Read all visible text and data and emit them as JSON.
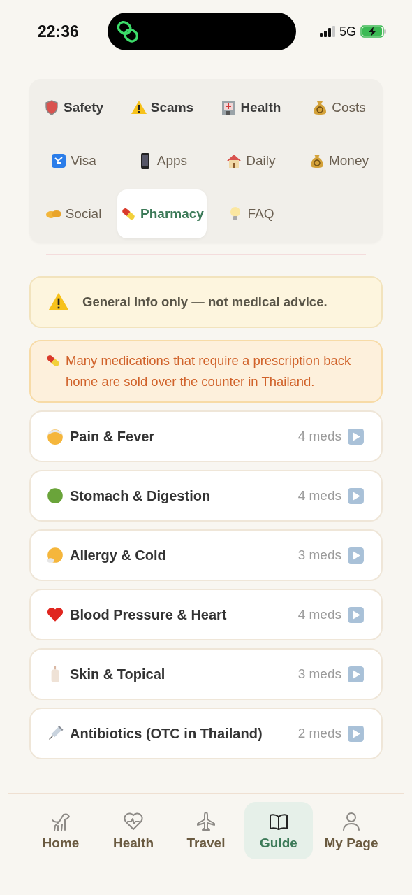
{
  "status_bar": {
    "time": "22:36",
    "network": "5G"
  },
  "tabs": [
    {
      "label": "Safety",
      "strong": true,
      "selected": false
    },
    {
      "label": "Scams",
      "strong": true,
      "selected": false
    },
    {
      "label": "Health",
      "strong": true,
      "selected": false
    },
    {
      "label": "Costs",
      "strong": false,
      "selected": false
    },
    {
      "label": "Visa",
      "strong": false,
      "selected": false
    },
    {
      "label": "Apps",
      "strong": false,
      "selected": false
    },
    {
      "label": "Daily",
      "strong": false,
      "selected": false
    },
    {
      "label": "Money",
      "strong": false,
      "selected": false
    },
    {
      "label": "Social",
      "strong": false,
      "selected": false
    },
    {
      "label": "Pharmacy",
      "strong": false,
      "selected": true
    },
    {
      "label": "FAQ",
      "strong": false,
      "selected": false
    }
  ],
  "notices": [
    {
      "kind": "warning",
      "text": "General info only — not medical advice."
    },
    {
      "kind": "info",
      "text": "Many medications that require a prescription back home are sold over the counter in Thailand."
    }
  ],
  "categories": [
    {
      "name": "Pain & Fever",
      "count": "4 meds"
    },
    {
      "name": "Stomach & Digestion",
      "count": "4 meds"
    },
    {
      "name": "Allergy & Cold",
      "count": "3 meds"
    },
    {
      "name": "Blood Pressure & Heart",
      "count": "4 meds"
    },
    {
      "name": "Skin & Topical",
      "count": "3 meds"
    },
    {
      "name": "Antibiotics (OTC in Thailand)",
      "count": "2 meds"
    }
  ],
  "bottom_nav": [
    {
      "label": "Home",
      "selected": false
    },
    {
      "label": "Health",
      "selected": false
    },
    {
      "label": "Travel",
      "selected": false
    },
    {
      "label": "Guide",
      "selected": true
    },
    {
      "label": "My Page",
      "selected": false
    }
  ]
}
